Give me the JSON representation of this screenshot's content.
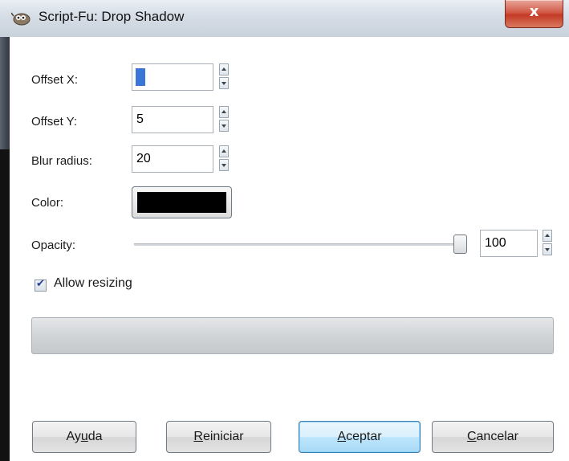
{
  "window": {
    "title": "Script-Fu: Drop Shadow",
    "close_label": "x",
    "icon": "gimp-wilber-icon"
  },
  "fields": {
    "offset_x": {
      "label": "Offset X:",
      "value": "5"
    },
    "offset_y": {
      "label": "Offset Y:",
      "value": "5"
    },
    "blur_radius": {
      "label": "Blur radius:",
      "value": "20"
    },
    "color": {
      "label": "Color:",
      "value": "#000000"
    },
    "opacity": {
      "label": "Opacity:",
      "value": "100",
      "level_percent": 100
    }
  },
  "allow_resizing": {
    "label": "Allow resizing",
    "checked": true
  },
  "buttons": {
    "help": {
      "before": "Ay",
      "mnemonic": "u",
      "after": "da"
    },
    "reset": {
      "before": "",
      "mnemonic": "R",
      "after": "einiciar"
    },
    "ok": {
      "before": "",
      "mnemonic": "A",
      "after": "ceptar"
    },
    "cancel": {
      "before": "",
      "mnemonic": "C",
      "after": "ancelar"
    }
  }
}
